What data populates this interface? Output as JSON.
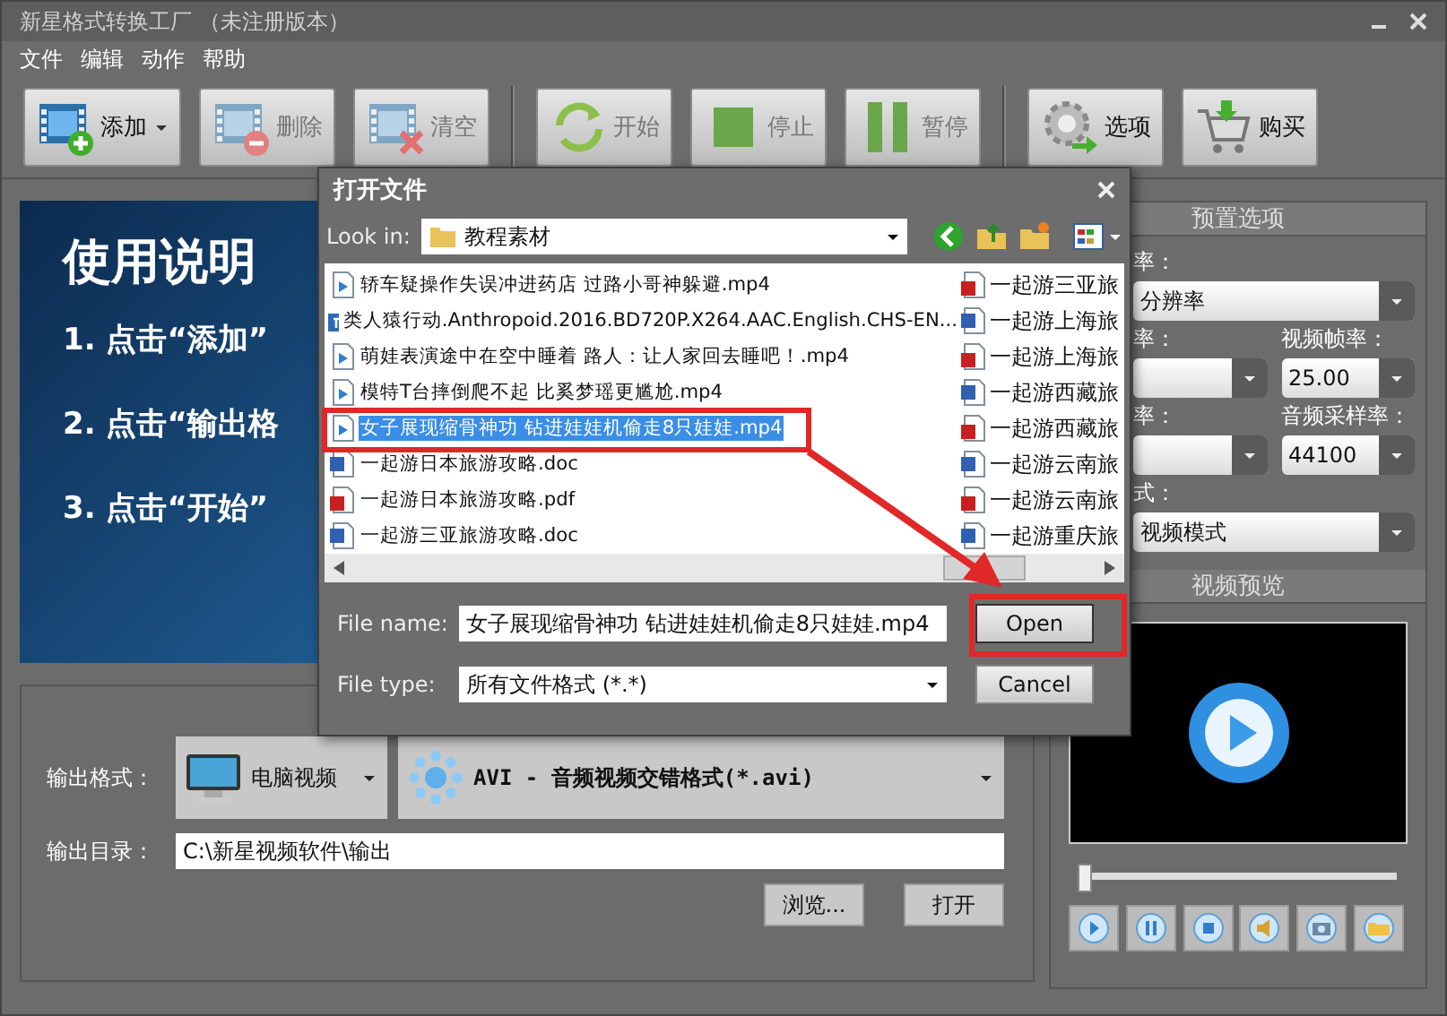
{
  "window": {
    "title": "新星格式转换工厂 （未注册版本）"
  },
  "menu": [
    "文件",
    "编辑",
    "动作",
    "帮助"
  ],
  "toolbar": [
    [
      {
        "kind": "add",
        "label": "添加",
        "disabled": false,
        "dropdown": true
      },
      {
        "kind": "delete",
        "label": "删除",
        "disabled": true,
        "dropdown": false
      },
      {
        "kind": "clear",
        "label": "清空",
        "disabled": true,
        "dropdown": false
      }
    ],
    [
      {
        "kind": "start",
        "label": "开始",
        "disabled": true,
        "dropdown": false
      },
      {
        "kind": "stop",
        "label": "停止",
        "disabled": true,
        "dropdown": false
      },
      {
        "kind": "pause",
        "label": "暂停",
        "disabled": true,
        "dropdown": false
      }
    ],
    [
      {
        "kind": "options",
        "label": "选项",
        "disabled": false,
        "dropdown": false
      },
      {
        "kind": "buy",
        "label": "购买",
        "disabled": false,
        "dropdown": false
      }
    ]
  ],
  "instructions": {
    "title": "使用说明",
    "steps": [
      "1. 点击“添加”",
      "2. 点击“输出格",
      "3. 点击“开始”"
    ]
  },
  "output": {
    "format_label": "输出格式：",
    "device": "电脑视频",
    "format": "AVI - 音频视频交错格式(*.avi)",
    "dir_label": "输出目录：",
    "dir": "C:\\新星视频软件\\输出",
    "buttons": [
      "浏览...",
      "打开"
    ]
  },
  "presets": {
    "title": "预置选项",
    "fields": [
      {
        "kind": "wide",
        "label": "率：",
        "value": "分辨率"
      },
      {
        "kind": "half",
        "label": "率："
      },
      {
        "kind": "half",
        "label": "视频帧率：",
        "value": "25.00"
      },
      {
        "kind": "half",
        "label": "率："
      },
      {
        "kind": "half",
        "label": "音频采样率：",
        "value": "44100"
      },
      {
        "kind": "wide",
        "label": "式：",
        "value": "视频模式"
      }
    ]
  },
  "preview": {
    "title": "视频预览",
    "seek": {
      "level": 0
    }
  },
  "dialog": {
    "title": "打开文件",
    "look_in_label": "Look in:",
    "look_in": "教程素材",
    "columns": [
      [
        {
          "kind": "video",
          "name": "轿车疑操作失误冲进药店 过路小哥神躲避.mp4",
          "selected": false
        },
        {
          "kind": "bt",
          "name": "类人猿行动.Anthropoid.2016.BD720P.X264.AAC.English.CHS-EN...",
          "selected": false
        },
        {
          "kind": "video",
          "name": "萌娃表演途中在空中睡着 路人：让人家回去睡吧！.mp4",
          "selected": false
        },
        {
          "kind": "video",
          "name": "模特T台摔倒爬不起 比奚梦瑶更尴尬.mp4",
          "selected": false
        },
        {
          "kind": "video",
          "name": "女子展现缩骨神功 钻进娃娃机偷走8只娃娃.mp4",
          "selected": true
        },
        {
          "kind": "doc",
          "name": "一起游日本旅游攻略.doc",
          "selected": false
        },
        {
          "kind": "pdf",
          "name": "一起游日本旅游攻略.pdf",
          "selected": false
        },
        {
          "kind": "doc",
          "name": "一起游三亚旅游攻略.doc",
          "selected": false
        }
      ],
      [
        {
          "kind": "pdf",
          "name": "一起游三亚旅",
          "selected": false
        },
        {
          "kind": "doc",
          "name": "一起游上海旅",
          "selected": false
        },
        {
          "kind": "pdf",
          "name": "一起游上海旅",
          "selected": false
        },
        {
          "kind": "doc",
          "name": "一起游西藏旅",
          "selected": false
        },
        {
          "kind": "pdf",
          "name": "一起游西藏旅",
          "selected": false
        },
        {
          "kind": "doc",
          "name": "一起游云南旅",
          "selected": false
        },
        {
          "kind": "pdf",
          "name": "一起游云南旅",
          "selected": false
        },
        {
          "kind": "doc",
          "name": "一起游重庆旅",
          "selected": false
        }
      ]
    ],
    "file_name_label": "File name:",
    "file_name": "女子展现缩骨神功 钻进娃娃机偷走8只娃娃.mp4",
    "file_type_label": "File type:",
    "file_type": "所有文件格式 (*.*)",
    "buttons": [
      {
        "label": "Open",
        "default": true
      },
      {
        "label": "Cancel",
        "default": false
      }
    ]
  }
}
